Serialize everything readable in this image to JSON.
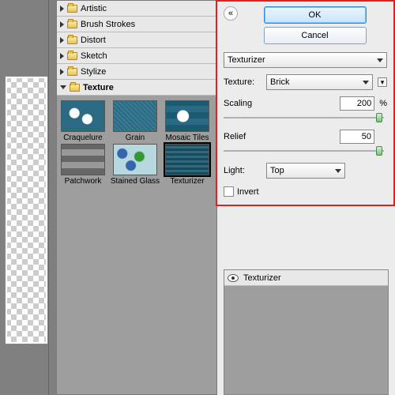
{
  "categories": [
    {
      "label": "Artistic",
      "expanded": false
    },
    {
      "label": "Brush Strokes",
      "expanded": false
    },
    {
      "label": "Distort",
      "expanded": false
    },
    {
      "label": "Sketch",
      "expanded": false
    },
    {
      "label": "Stylize",
      "expanded": false
    },
    {
      "label": "Texture",
      "expanded": true
    }
  ],
  "thumbs": [
    {
      "label": "Craquelure"
    },
    {
      "label": "Grain"
    },
    {
      "label": "Mosaic Tiles"
    },
    {
      "label": "Patchwork"
    },
    {
      "label": "Stained Glass"
    },
    {
      "label": "Texturizer"
    }
  ],
  "buttons": {
    "ok": "OK",
    "cancel": "Cancel"
  },
  "filter": {
    "name": "Texturizer",
    "texture_label": "Texture:",
    "texture_value": "Brick",
    "scaling_label": "Scaling",
    "scaling_value": "200",
    "scaling_unit": "%",
    "relief_label": "Relief",
    "relief_value": "50",
    "light_label": "Light:",
    "light_value": "Top",
    "invert_label": "Invert"
  },
  "preview": {
    "title": "Texturizer"
  },
  "collapse_glyph": "«"
}
